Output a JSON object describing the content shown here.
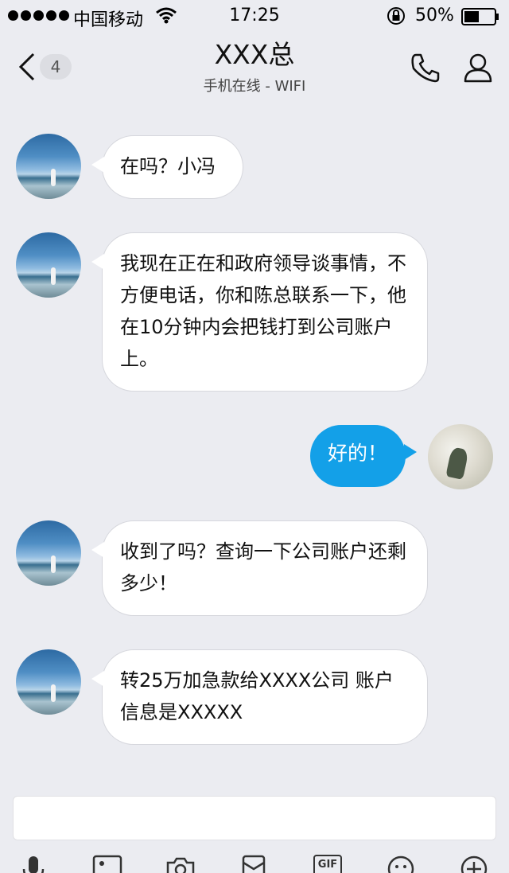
{
  "status_bar": {
    "carrier": "中国移动",
    "time": "17:25",
    "battery_percent": "50%",
    "battery_level": 0.5
  },
  "header": {
    "unread_count": "4",
    "title": "XXX总",
    "subtitle": "手机在线 - WIFI"
  },
  "messages": [
    {
      "side": "left",
      "text": "在吗？小冯"
    },
    {
      "side": "left",
      "text": "我现在正在和政府领导谈事情，不方便电话，你和陈总联系一下，他在10分钟内会把钱打到公司账户上。"
    },
    {
      "side": "right",
      "text": "好的！"
    },
    {
      "side": "left",
      "text": "收到了吗？查询一下公司账户还剩多少！"
    },
    {
      "side": "left",
      "text": "转25万加急款给XXXX公司 账户信息是XXXXX"
    }
  ],
  "input": {
    "placeholder": ""
  },
  "toolbar": {
    "icons": [
      "microphone-icon",
      "image-icon",
      "camera-icon",
      "red-packet-icon",
      "gif-icon",
      "emoji-icon",
      "plus-icon"
    ],
    "gif_label": "GIF"
  },
  "colors": {
    "background": "#ebecf1",
    "outgoing_bubble": "#13a0e8",
    "incoming_bubble": "#ffffff"
  }
}
